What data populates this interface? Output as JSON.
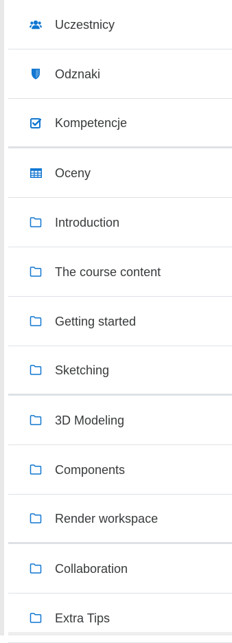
{
  "colors": {
    "icon_blue": "#1177d1",
    "text": "#373a3c",
    "divider": "#dee2e6"
  },
  "nav": {
    "items": [
      {
        "label": "Uczestnicy",
        "icon": "users-icon"
      },
      {
        "label": "Odznaki",
        "icon": "shield-icon"
      },
      {
        "label": "Kompetencje",
        "icon": "checkbox-icon"
      },
      {
        "label": "Oceny",
        "icon": "table-icon"
      },
      {
        "label": "Introduction",
        "icon": "folder-icon"
      },
      {
        "label": "The course content",
        "icon": "folder-icon"
      },
      {
        "label": "Getting started",
        "icon": "folder-icon"
      },
      {
        "label": "Sketching",
        "icon": "folder-icon"
      },
      {
        "label": "3D Modeling",
        "icon": "folder-icon"
      },
      {
        "label": "Components",
        "icon": "folder-icon"
      },
      {
        "label": "Render workspace",
        "icon": "folder-icon"
      },
      {
        "label": "Collaboration",
        "icon": "folder-icon"
      },
      {
        "label": "Extra Tips",
        "icon": "folder-icon"
      }
    ]
  }
}
